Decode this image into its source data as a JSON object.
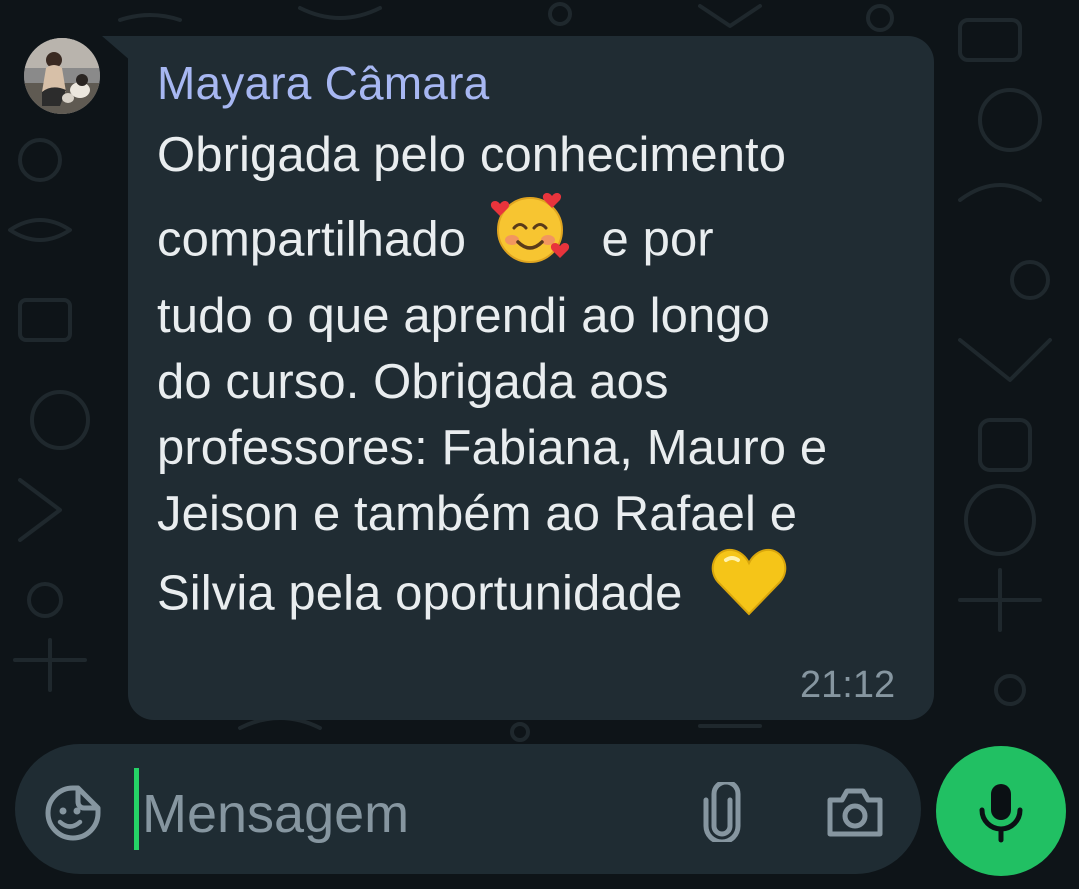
{
  "chat": {
    "sender_name": "Mayara Câmara",
    "message_lines": [
      "Obrigada pelo conhecimento",
      "compartilhado",
      "e por",
      "tudo o que aprendi ao longo",
      "do curso. Obrigada aos",
      "professores: Fabiana, Mauro e",
      "Jeison e também ao Rafael e",
      "Silvia pela oportunidade"
    ],
    "emojis": [
      "smiling-face-with-hearts",
      "yellow-heart"
    ],
    "time": "21:12"
  },
  "composer": {
    "placeholder": "Mensagem",
    "icons": [
      "sticker-icon",
      "attach-icon",
      "camera-icon",
      "mic-icon"
    ]
  },
  "colors": {
    "bubble": "#202c33",
    "sender": "#a7b7f2",
    "text": "#e9edef",
    "accent": "#21c063",
    "muted": "#8696a0"
  }
}
